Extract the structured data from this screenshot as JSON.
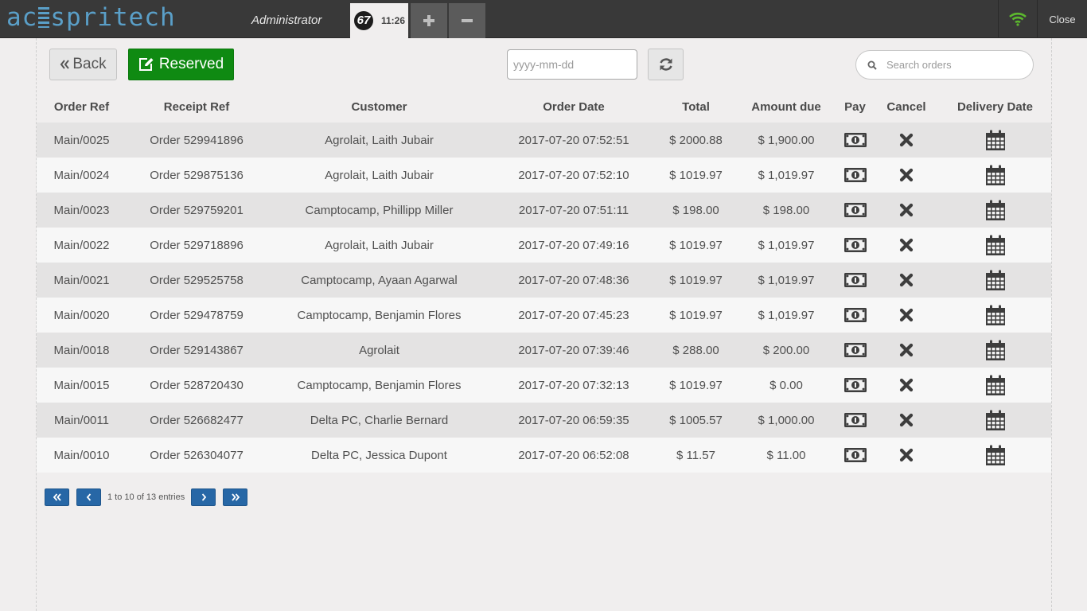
{
  "header": {
    "logo_text_left": "ac",
    "logo_text_right": "spritech",
    "username": "Administrator",
    "order_tab": {
      "sequence": "67",
      "time": "11:26"
    },
    "add_order_icon": "plus-icon",
    "remove_order_icon": "minus-icon",
    "connection_icon": "wifi-icon",
    "close_label": "Close",
    "colors": {
      "bar": "#393939",
      "logo": "#5a9fc8",
      "wifi": "#5cb82e"
    }
  },
  "toolbar": {
    "back_label": "Back",
    "reserved_label": "Reserved",
    "date_placeholder": "yyyy-mm-dd",
    "refresh_icon": "refresh-icon",
    "search_placeholder": "Search orders",
    "colors": {
      "reserved": "#0f8a12"
    }
  },
  "table": {
    "columns": [
      "Order Ref",
      "Receipt Ref",
      "Customer",
      "Order Date",
      "Total",
      "Amount due",
      "Pay",
      "Cancel",
      "Delivery Date"
    ],
    "rows": [
      {
        "order_ref": "Main/0025",
        "receipt_ref": "Order 529941896",
        "customer": "Agrolait, Laith Jubair",
        "order_date": "2017-07-20 07:52:51",
        "total": "$ 2000.88",
        "amount_due": "$ 1,900.00"
      },
      {
        "order_ref": "Main/0024",
        "receipt_ref": "Order 529875136",
        "customer": "Agrolait, Laith Jubair",
        "order_date": "2017-07-20 07:52:10",
        "total": "$ 1019.97",
        "amount_due": "$ 1,019.97"
      },
      {
        "order_ref": "Main/0023",
        "receipt_ref": "Order 529759201",
        "customer": "Camptocamp, Phillipp Miller",
        "order_date": "2017-07-20 07:51:11",
        "total": "$ 198.00",
        "amount_due": "$ 198.00"
      },
      {
        "order_ref": "Main/0022",
        "receipt_ref": "Order 529718896",
        "customer": "Agrolait, Laith Jubair",
        "order_date": "2017-07-20 07:49:16",
        "total": "$ 1019.97",
        "amount_due": "$ 1,019.97"
      },
      {
        "order_ref": "Main/0021",
        "receipt_ref": "Order 529525758",
        "customer": "Camptocamp, Ayaan Agarwal",
        "order_date": "2017-07-20 07:48:36",
        "total": "$ 1019.97",
        "amount_due": "$ 1,019.97"
      },
      {
        "order_ref": "Main/0020",
        "receipt_ref": "Order 529478759",
        "customer": "Camptocamp, Benjamin Flores",
        "order_date": "2017-07-20 07:45:23",
        "total": "$ 1019.97",
        "amount_due": "$ 1,019.97"
      },
      {
        "order_ref": "Main/0018",
        "receipt_ref": "Order 529143867",
        "customer": "Agrolait",
        "order_date": "2017-07-20 07:39:46",
        "total": "$ 288.00",
        "amount_due": "$ 200.00"
      },
      {
        "order_ref": "Main/0015",
        "receipt_ref": "Order 528720430",
        "customer": "Camptocamp, Benjamin Flores",
        "order_date": "2017-07-20 07:32:13",
        "total": "$ 1019.97",
        "amount_due": "$ 0.00"
      },
      {
        "order_ref": "Main/0011",
        "receipt_ref": "Order 526682477",
        "customer": "Delta PC, Charlie Bernard",
        "order_date": "2017-07-20 06:59:35",
        "total": "$ 1005.57",
        "amount_due": "$ 1,000.00"
      },
      {
        "order_ref": "Main/0010",
        "receipt_ref": "Order 526304077",
        "customer": "Delta PC, Jessica Dupont",
        "order_date": "2017-07-20 06:52:08",
        "total": "$ 11.57",
        "amount_due": "$ 11.00"
      }
    ],
    "row_icons": {
      "pay": "money-icon",
      "cancel": "close-x-icon",
      "delivery": "calendar-icon"
    }
  },
  "pagination": {
    "info": "1 to 10 of 13 entries",
    "first_icon": "double-chevron-left-icon",
    "prev_icon": "chevron-left-icon",
    "next_icon": "chevron-right-icon",
    "last_icon": "double-chevron-right-icon",
    "colors": {
      "button": "#2767a6"
    }
  }
}
